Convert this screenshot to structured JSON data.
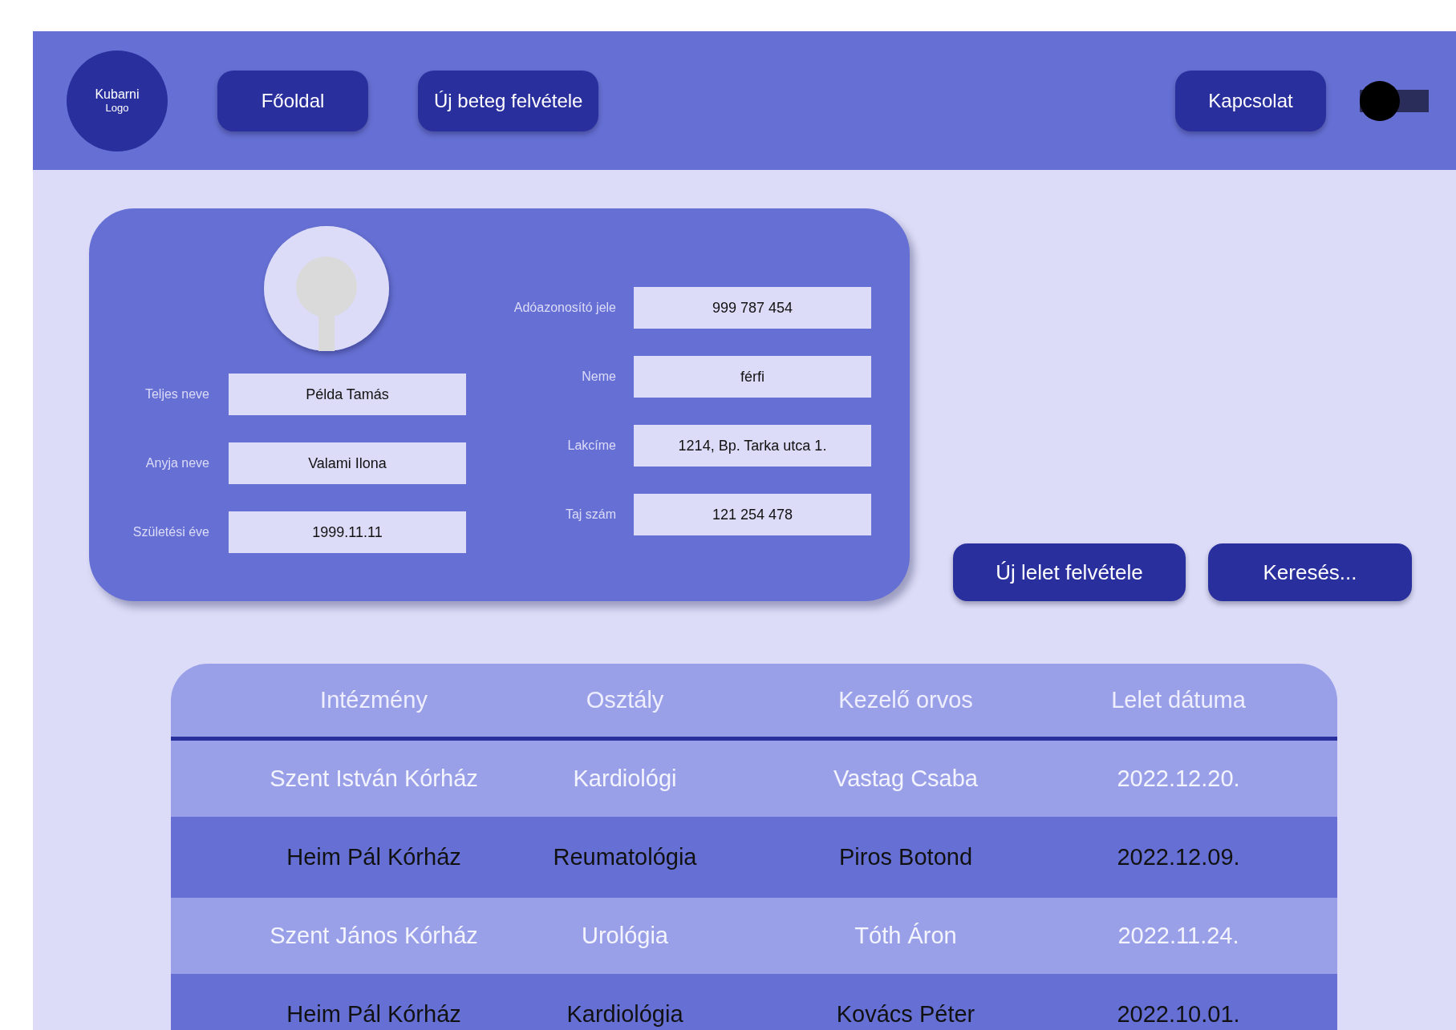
{
  "header": {
    "logo": [
      "Kubarni",
      "Logo"
    ],
    "nav": [
      "Főoldal",
      "Új beteg felvétele"
    ],
    "contact": "Kapcsolat",
    "toggle": {
      "on": false
    }
  },
  "patient": {
    "left_fields": [
      {
        "label": "Teljes neve",
        "value": "Példa Tamás"
      },
      {
        "label": "Anyja neve",
        "value": "Valami Ilona"
      },
      {
        "label": "Születési éve",
        "value": "1999.11.11"
      }
    ],
    "right_fields": [
      {
        "label": "Adóazonosító jele",
        "value": "999 787 454"
      },
      {
        "label": "Neme",
        "value": "férfi"
      },
      {
        "label": "Lakcíme",
        "value": "1214, Bp. Tarka utca 1."
      },
      {
        "label": "Taj szám",
        "value": "121 254 478"
      }
    ]
  },
  "actions": [
    "Új lelet felvétele",
    "Keresés..."
  ],
  "table": {
    "columns": [
      "Intézmény",
      "Osztály",
      "Kezelő orvos",
      "Lelet dátuma"
    ],
    "rows": [
      [
        "Szent István Kórház",
        "Kardiológi",
        "Vastag Csaba",
        "2022.12.20."
      ],
      [
        "Heim Pál Kórház",
        "Reumatológia",
        "Piros Botond",
        "2022.12.09."
      ],
      [
        "Szent János Kórház",
        "Urológia",
        "Tóth Áron",
        "2022.11.24."
      ],
      [
        "Heim Pál Kórház",
        "Kardiológia",
        "Kovács Péter",
        "2022.10.01."
      ]
    ]
  }
}
